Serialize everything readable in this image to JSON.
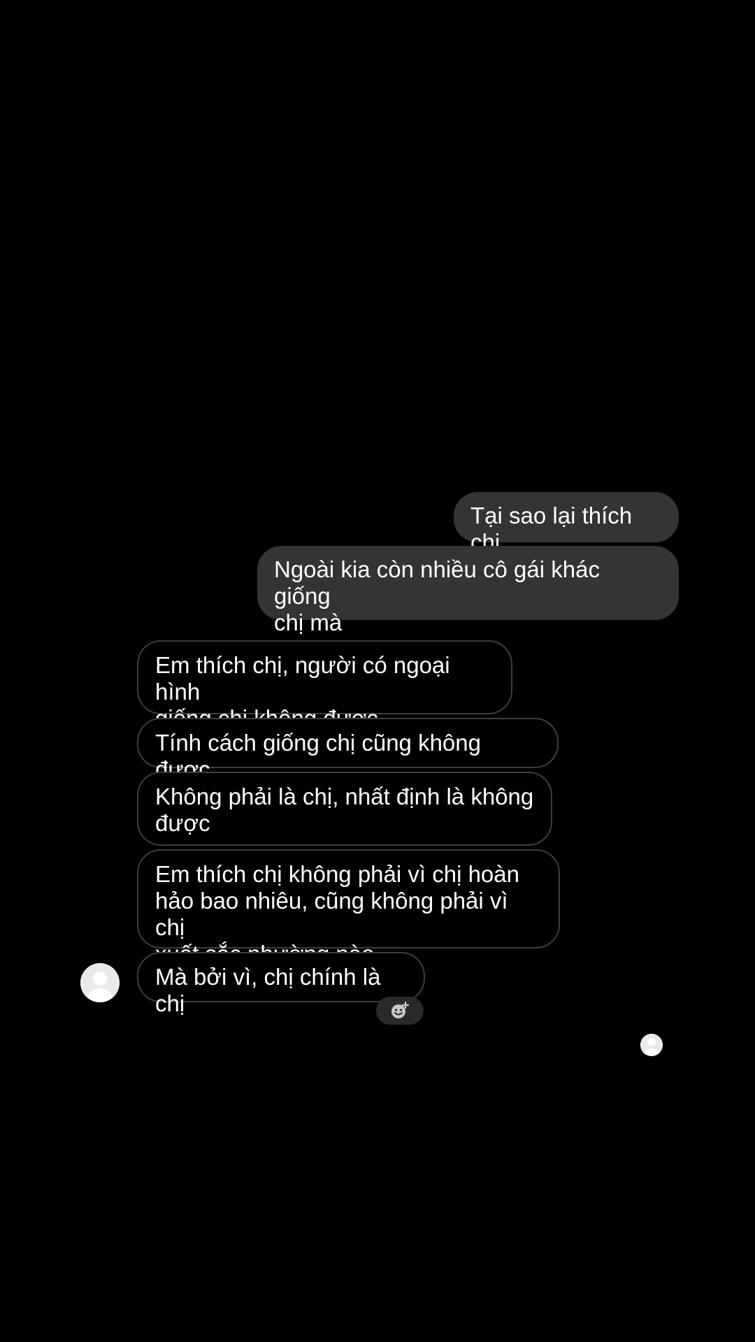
{
  "conversation": {
    "sent_messages": [
      "Tại sao lại thích chị",
      "Ngoài kia còn nhiều cô gái khác giống\nchị mà"
    ],
    "received_messages": [
      "Em thích chị, người có ngoại hình\ngiống chị không được",
      "Tính cách giống chị cũng không được",
      "Không phải là chị, nhất định là không\nđược",
      "Em thích chị không phải vì chị hoàn\nhảo bao nhiêu, cũng không phải vì chị\nxuất sắc nhường nào",
      "Mà bởi vì, chị chính là chị"
    ],
    "icons": {
      "sender_avatar": "avatar-icon",
      "reaction": "add-reaction-icon",
      "seen_avatar": "seen-avatar-icon"
    }
  },
  "colors": {
    "background": "#000000",
    "sent_bubble": "#343434",
    "received_border": "#3e3e3e",
    "text": "#ffffff"
  }
}
